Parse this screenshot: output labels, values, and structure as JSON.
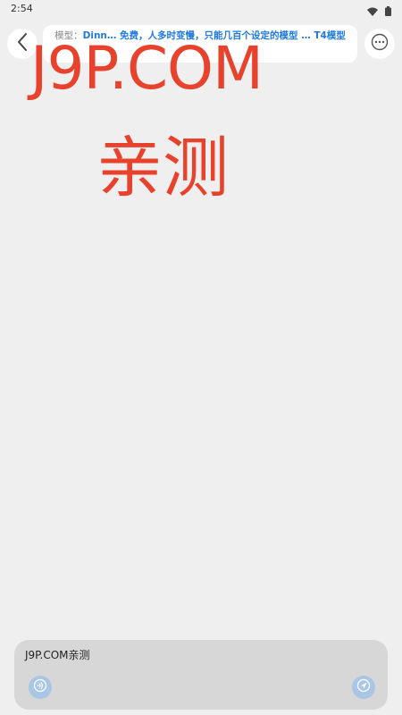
{
  "status_bar": {
    "time": "2:54"
  },
  "header": {
    "model_prefix": "模型：",
    "model_description": "Dinn… 免费，人多时变慢，只能几百个设定的模型 … T4模型"
  },
  "watermark": {
    "line1": "J9P.COM",
    "line2": "亲测"
  },
  "composer": {
    "input_value": "J9P.COM亲测"
  },
  "icons": {
    "back": "chevron-left-icon",
    "more": "more-dots-icon",
    "voice": "voice-icon",
    "send": "send-icon",
    "wifi": "wifi-icon",
    "battery": "battery-icon"
  },
  "colors": {
    "accent": "#1f7ae0",
    "watermark": "#e8422d",
    "composer_bg": "#d7d7d7",
    "button_bg": "#a9c6e6"
  }
}
